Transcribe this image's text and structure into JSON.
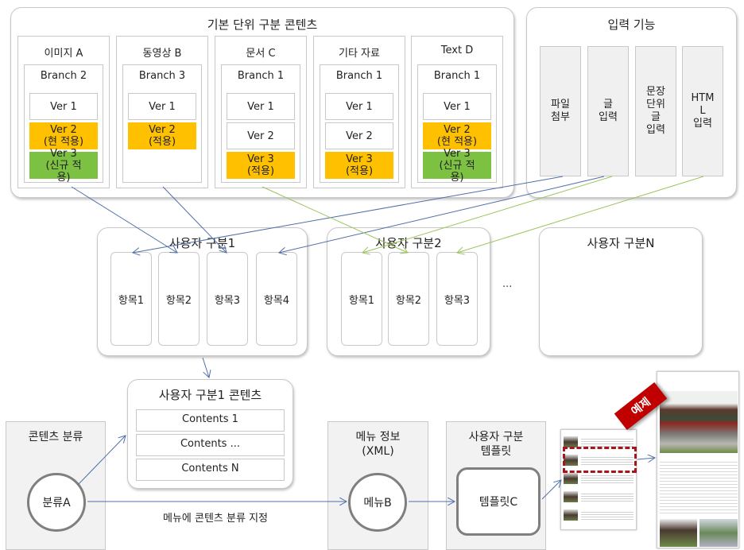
{
  "basic_units": {
    "title": "기본 단위 구분 콘텐츠",
    "columns": [
      {
        "title": "이미지 A",
        "branch": "Branch 2",
        "versions": [
          {
            "lines": [
              "Ver 1"
            ],
            "state": "normal"
          },
          {
            "lines": [
              "Ver 2",
              "(현 적용)"
            ],
            "state": "applied"
          },
          {
            "lines": [
              "Ver 3",
              "(신규 적",
              "용)"
            ],
            "state": "new"
          }
        ]
      },
      {
        "title": "동영상 B",
        "branch": "Branch 3",
        "versions": [
          {
            "lines": [
              "Ver 1"
            ],
            "state": "normal"
          },
          {
            "lines": [
              "Ver 2",
              "(적용)"
            ],
            "state": "applied"
          }
        ]
      },
      {
        "title": "문서 C",
        "branch": "Branch 1",
        "versions": [
          {
            "lines": [
              "Ver 1"
            ],
            "state": "normal"
          },
          {
            "lines": [
              "Ver 2"
            ],
            "state": "normal"
          },
          {
            "lines": [
              "Ver 3",
              "(적용)"
            ],
            "state": "applied"
          }
        ]
      },
      {
        "title": "기타 자료",
        "branch": "Branch 1",
        "versions": [
          {
            "lines": [
              "Ver 1"
            ],
            "state": "normal"
          },
          {
            "lines": [
              "Ver 2"
            ],
            "state": "normal"
          },
          {
            "lines": [
              "Ver 3",
              "(적용)"
            ],
            "state": "applied"
          }
        ]
      },
      {
        "title": "Text D",
        "branch": "Branch 1",
        "versions": [
          {
            "lines": [
              "Ver 1"
            ],
            "state": "normal"
          },
          {
            "lines": [
              "Ver 2",
              "(현 적용)"
            ],
            "state": "applied"
          },
          {
            "lines": [
              "Ver 3",
              "(신규 적",
              "용)"
            ],
            "state": "new"
          }
        ]
      }
    ]
  },
  "input_functions": {
    "title": "입력 기능",
    "items": [
      {
        "lines": [
          "파일",
          "첨부"
        ]
      },
      {
        "lines": [
          "글",
          "입력"
        ]
      },
      {
        "lines": [
          "문장",
          "단위",
          "글",
          "입력"
        ]
      },
      {
        "lines": [
          "HTM",
          "L",
          "입력"
        ]
      }
    ]
  },
  "user_groups": [
    {
      "title": "사용자 구분1",
      "items": [
        "항목1",
        "항목2",
        "항목3",
        "항목4"
      ]
    },
    {
      "title": "사용자 구분2",
      "items": [
        "항목1",
        "항목2",
        "항목3"
      ]
    },
    {
      "title": "사용자 구분N",
      "items": []
    }
  ],
  "ellipsis": "...",
  "user1_contents": {
    "title": "사용자 구분1 콘텐츠",
    "rows": [
      "Contents 1",
      "Contents ...",
      "Contents N"
    ]
  },
  "content_category": {
    "title": "콘텐츠 분류",
    "node": "분류A"
  },
  "menu_info": {
    "title_lines": [
      "메뉴 정보",
      "(XML)"
    ],
    "node": "메뉴B"
  },
  "user_template": {
    "title_lines": [
      "사용자 구분",
      "템플릿"
    ],
    "node": "템플릿C"
  },
  "edge_label": "메뉴에 콘텐츠 분류 지정",
  "example_badge": "예제",
  "colors": {
    "applied": "#ffc000",
    "new": "#7cc142",
    "blue_arrow": "#4f6fa8",
    "green_arrow": "#9bc45a",
    "badge": "#c00000"
  }
}
